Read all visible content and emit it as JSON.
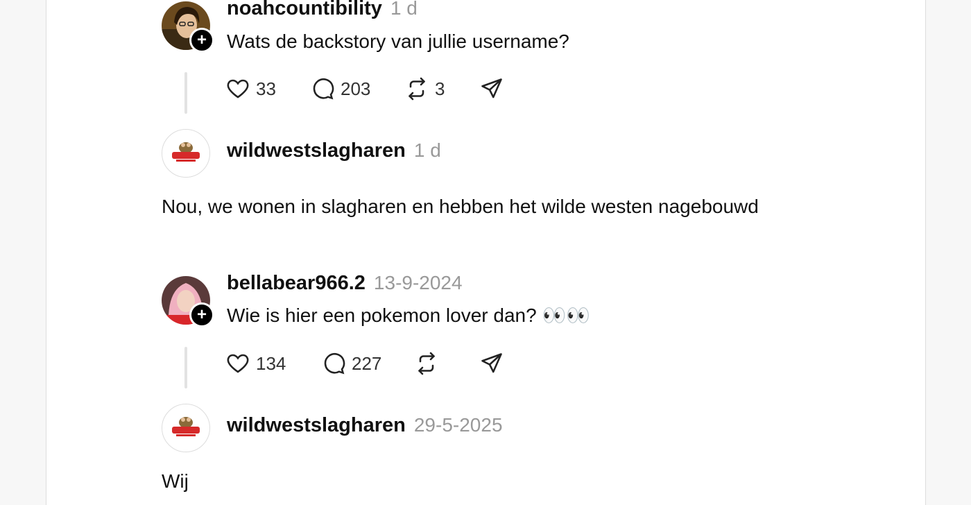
{
  "posts": [
    {
      "username": "noahcountibility",
      "time": "1 d",
      "text": "Wats de backstory van jullie username?",
      "likes": "33",
      "replies": "203",
      "reposts": "3"
    },
    {
      "username": "bellabear966.2",
      "time": "13-9-2024",
      "text": "Wie is hier een pokemon lover dan? 👀👀",
      "likes": "134",
      "replies": "227",
      "reposts": ""
    }
  ],
  "replies": [
    {
      "username": "wildwestslagharen",
      "time": "1 d",
      "text": "Nou, we wonen in slagharen en hebben het wilde westen nagebouwd"
    },
    {
      "username": "wildwestslagharen",
      "time": "29-5-2025",
      "text": "Wij"
    }
  ],
  "icons": {
    "like": "heart-icon",
    "reply": "comment-icon",
    "repost": "repost-icon",
    "share": "send-icon",
    "follow": "plus-icon"
  }
}
